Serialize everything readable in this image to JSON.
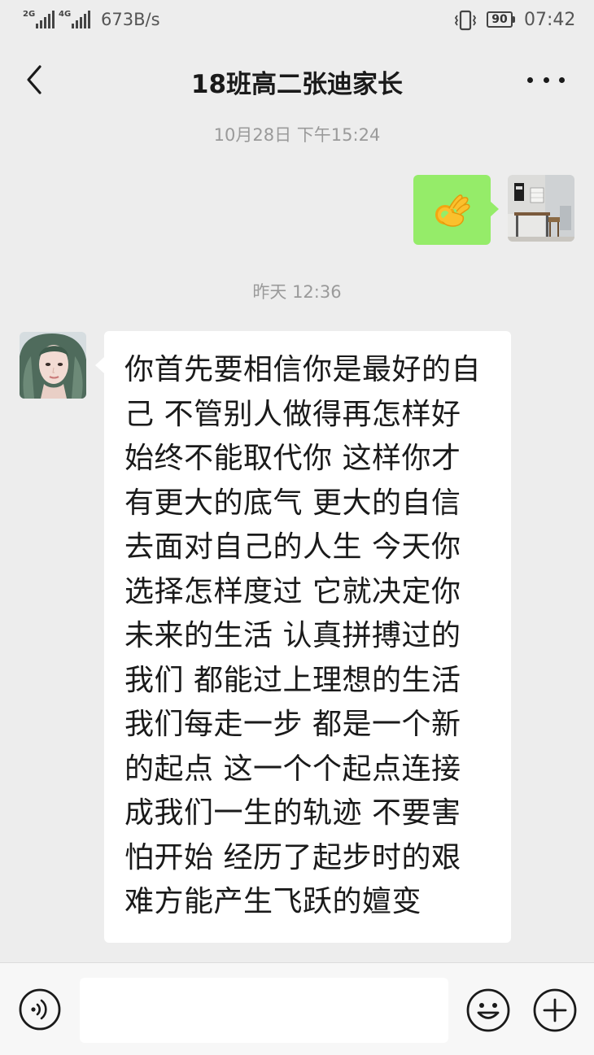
{
  "status_bar": {
    "signal_1_label": "2G",
    "signal_2_label": "4G",
    "net_speed": "673B/s",
    "battery": "90",
    "time": "07:42"
  },
  "header": {
    "title": "18班高二张迪家长",
    "back_icon": "chevron-left-icon",
    "more_icon": "more-dots-icon"
  },
  "messages": [
    {
      "timestamp": "10月28日 下午15:24",
      "direction": "sent",
      "content_type": "sticker",
      "sticker": "ok-hand-emoji"
    },
    {
      "timestamp": "昨天 12:36",
      "direction": "received",
      "content_type": "text",
      "lines": [
        "你首先要相信你是最好的自",
        "己 不管别人做得再怎样好",
        "始终不能取代你 这样你才",
        "有更大的底气 更大的自信",
        "去面对自己的人生 今天你",
        "选择怎样度过 它就决定你",
        "未来的生活 认真拼搏过的",
        "我们 都能过上理想的生活",
        "我们每走一步 都是一个新",
        "的起点 这一个个起点连接",
        "成我们一生的轨迹 不要害",
        "怕开始 经历了起步时的艰",
        "难方能产生飞跃的嬗变"
      ]
    }
  ],
  "input_bar": {
    "voice_icon": "voice-icon",
    "input_value": "",
    "emoji_icon": "smiley-icon",
    "plus_icon": "plus-circle-icon"
  },
  "colors": {
    "background": "#ededed",
    "sent_bubble": "#95ec69",
    "received_bubble": "#ffffff",
    "timestamp_text": "#9a9a9a"
  }
}
